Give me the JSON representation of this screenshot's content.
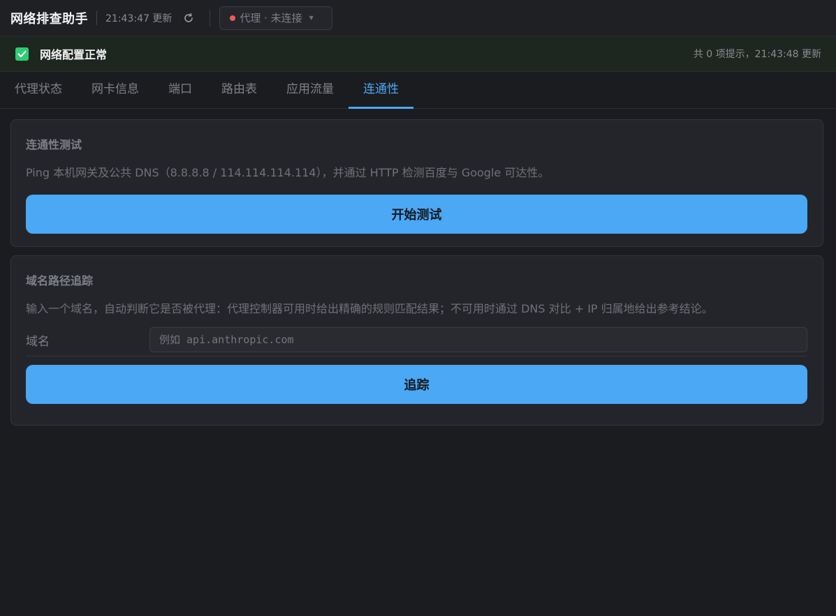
{
  "header": {
    "title": "网络排查助手",
    "update_time": "21:43:47 更新",
    "proxy_status": "代理 · 未连接",
    "status_color": "#ef5b5b"
  },
  "banner": {
    "title": "网络配置正常",
    "summary": "共 0 项提示，21:43:48 更新"
  },
  "tabs": [
    {
      "label": "代理状态",
      "active": false
    },
    {
      "label": "网卡信息",
      "active": false
    },
    {
      "label": "端口",
      "active": false
    },
    {
      "label": "路由表",
      "active": false
    },
    {
      "label": "应用流量",
      "active": false
    },
    {
      "label": "连通性",
      "active": true
    }
  ],
  "connectivity": {
    "title": "连通性测试",
    "description": "Ping 本机网关及公共 DNS（8.8.8.8 / 114.114.114.114），并通过 HTTP 检测百度与 Google 可达性。",
    "button_label": "开始测试"
  },
  "trace": {
    "title": "域名路径追踪",
    "description": "输入一个域名，自动判断它是否被代理：代理控制器可用时给出精确的规则匹配结果；不可用时通过 DNS 对比 + IP 归属地给出参考结论。",
    "field_label": "域名",
    "field_value": "",
    "field_placeholder": "例如 api.anthropic.com",
    "button_label": "追踪"
  },
  "colors": {
    "accent": "#4aa8f5",
    "ok": "#2ecc71",
    "background": "#1b1c20"
  }
}
